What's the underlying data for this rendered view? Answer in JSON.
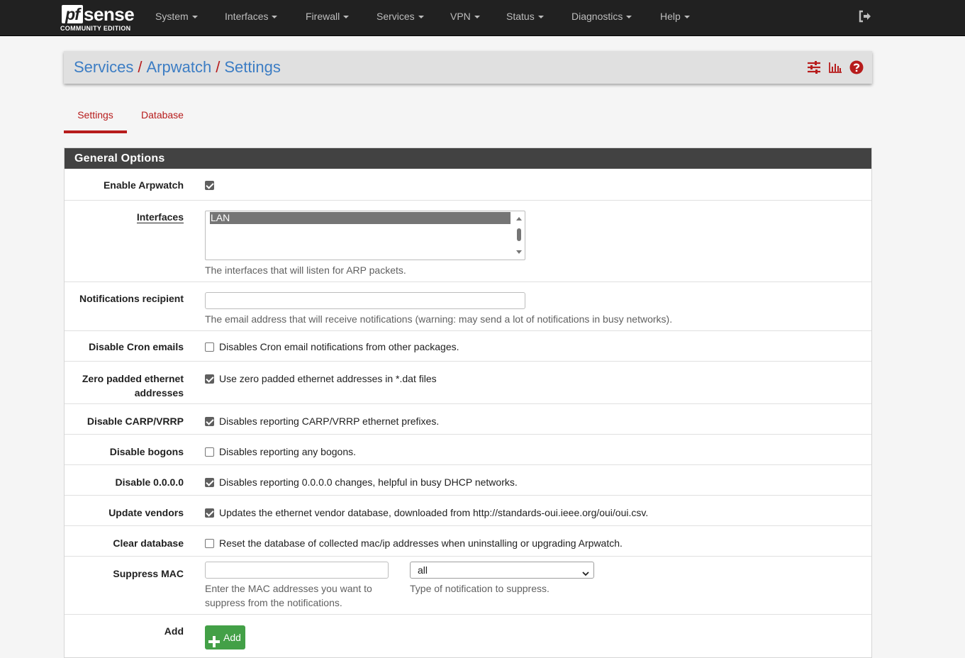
{
  "brand": {
    "pf": "pf",
    "sense": "sense",
    "edition": "COMMUNITY EDITION"
  },
  "nav": {
    "items": [
      "System",
      "Interfaces",
      "Firewall",
      "Services",
      "VPN",
      "Status",
      "Diagnostics",
      "Help"
    ],
    "logout_icon": "sign-out-icon"
  },
  "breadcrumb": {
    "items": [
      "Services",
      "Arpwatch",
      "Settings"
    ],
    "separator": "/",
    "icons": [
      "sliders-icon",
      "bar-chart-icon",
      "question-circle-icon"
    ]
  },
  "tabs": [
    {
      "label": "Settings",
      "active": true
    },
    {
      "label": "Database",
      "active": false
    }
  ],
  "panel": {
    "title": "General Options",
    "enable": {
      "label": "Enable Arpwatch",
      "checked": true
    },
    "interfaces": {
      "label": "Interfaces",
      "options": [
        "LAN"
      ],
      "selected": "LAN",
      "help": "The interfaces that will listen for ARP packets."
    },
    "notifications": {
      "label": "Notifications recipient",
      "value": "",
      "help": "The email address that will receive notifications (warning: may send a lot of notifications in busy networks)."
    },
    "disable_cron": {
      "label": "Disable Cron emails",
      "checked": false,
      "text": "Disables Cron email notifications from other packages."
    },
    "zero_padded": {
      "label_line1": "Zero padded ethernet",
      "label_line2": "addresses",
      "checked": true,
      "text": "Use zero padded ethernet addresses in *.dat files"
    },
    "disable_carp": {
      "label": "Disable CARP/VRRP",
      "checked": true,
      "text": "Disables reporting CARP/VRRP ethernet prefixes."
    },
    "disable_bogons": {
      "label": "Disable bogons",
      "checked": false,
      "text": "Disables reporting any bogons."
    },
    "disable_zero": {
      "label": "Disable 0.0.0.0",
      "checked": true,
      "text": "Disables reporting 0.0.0.0 changes, helpful in busy DHCP networks."
    },
    "update_vendors": {
      "label": "Update vendors",
      "checked": true,
      "text": "Updates the ethernet vendor database, downloaded from http://standards-oui.ieee.org/oui/oui.csv."
    },
    "clear_db": {
      "label": "Clear database",
      "checked": false,
      "text": "Reset the database of collected mac/ip addresses when uninstalling or upgrading Arpwatch."
    },
    "suppress_mac": {
      "label": "Suppress MAC",
      "mac_value": "",
      "mac_help_line1": "Enter the MAC addresses you want to",
      "mac_help_line2": "suppress from the notifications.",
      "type_value": "all",
      "type_help": "Type of notification to suppress."
    },
    "add": {
      "label": "Add",
      "button": "Add"
    }
  },
  "colors": {
    "accent_red": "#b71c1c",
    "link_blue": "#3c7dc4",
    "navbar": "#212121",
    "panel_head": "#424242",
    "add_green": "#43a047"
  }
}
